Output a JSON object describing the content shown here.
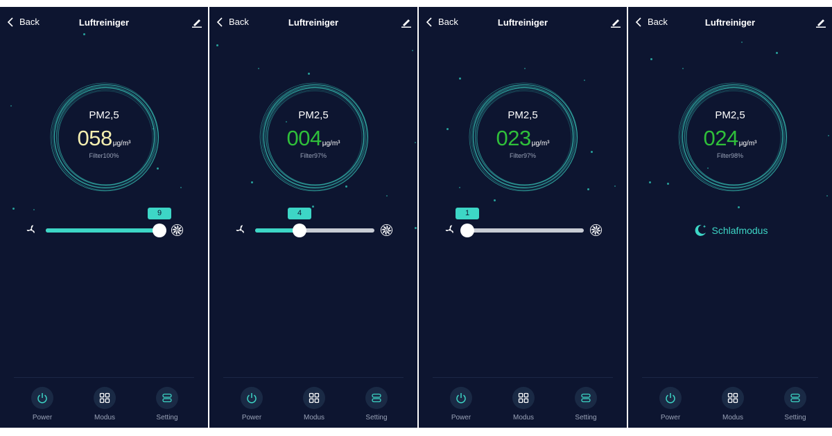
{
  "colors": {
    "background": "#0d1530",
    "accent": "#3dd6c6",
    "value_moderate": "#f4eeb0",
    "value_good": "#2fbf3a",
    "track_inactive": "#c8ccd4",
    "muted_text": "#9aa3b8"
  },
  "screens": [
    {
      "header": {
        "back_label": "Back",
        "title": "Luftreiniger",
        "back_icon": "chevron-left-icon",
        "edit_icon": "edit-pencil-icon"
      },
      "air": {
        "pm_label": "PM2,5",
        "pm_value": "058",
        "unit": "μg/m³",
        "filter": "Filter100%",
        "value_color": "#f4eeb0"
      },
      "fan": {
        "speed": "9",
        "level_fraction": 1.0,
        "low_icon": "fan-low-icon",
        "high_icon": "fan-high-icon"
      },
      "nav": [
        {
          "label": "Power",
          "icon": "power-icon"
        },
        {
          "label": "Modus",
          "icon": "grid-icon"
        },
        {
          "label": "Setting",
          "icon": "settings-icon"
        }
      ]
    },
    {
      "header": {
        "back_label": "Back",
        "title": "Luftreiniger",
        "back_icon": "chevron-left-icon",
        "edit_icon": "edit-pencil-icon"
      },
      "air": {
        "pm_label": "PM2,5",
        "pm_value": "004",
        "unit": "μg/m³",
        "filter": "Filter97%",
        "value_color": "#2fbf3a"
      },
      "fan": {
        "speed": "4",
        "level_fraction": 0.375,
        "low_icon": "fan-low-icon",
        "high_icon": "fan-high-icon"
      },
      "nav": [
        {
          "label": "Power",
          "icon": "power-icon"
        },
        {
          "label": "Modus",
          "icon": "grid-icon"
        },
        {
          "label": "Setting",
          "icon": "settings-icon"
        }
      ]
    },
    {
      "header": {
        "back_label": "Back",
        "title": "Luftreiniger",
        "back_icon": "chevron-left-icon",
        "edit_icon": "edit-pencil-icon"
      },
      "air": {
        "pm_label": "PM2,5",
        "pm_value": "023",
        "unit": "μg/m³",
        "filter": "Filter97%",
        "value_color": "#2fbf3a"
      },
      "fan": {
        "speed": "1",
        "level_fraction": 0.0,
        "low_icon": "fan-low-icon",
        "high_icon": "fan-high-icon"
      },
      "nav": [
        {
          "label": "Power",
          "icon": "power-icon"
        },
        {
          "label": "Modus",
          "icon": "grid-icon"
        },
        {
          "label": "Setting",
          "icon": "settings-icon"
        }
      ]
    },
    {
      "header": {
        "back_label": "Back",
        "title": "Luftreiniger",
        "back_icon": "chevron-left-icon",
        "edit_icon": "edit-pencil-icon"
      },
      "air": {
        "pm_label": "PM2,5",
        "pm_value": "024",
        "unit": "μg/m³",
        "filter": "Filter98%",
        "value_color": "#2fbf3a"
      },
      "sleep": {
        "label": "Schlafmodus",
        "icon": "moon-icon"
      },
      "nav": [
        {
          "label": "Power",
          "icon": "power-icon"
        },
        {
          "label": "Modus",
          "icon": "grid-icon"
        },
        {
          "label": "Setting",
          "icon": "settings-icon"
        }
      ]
    }
  ]
}
